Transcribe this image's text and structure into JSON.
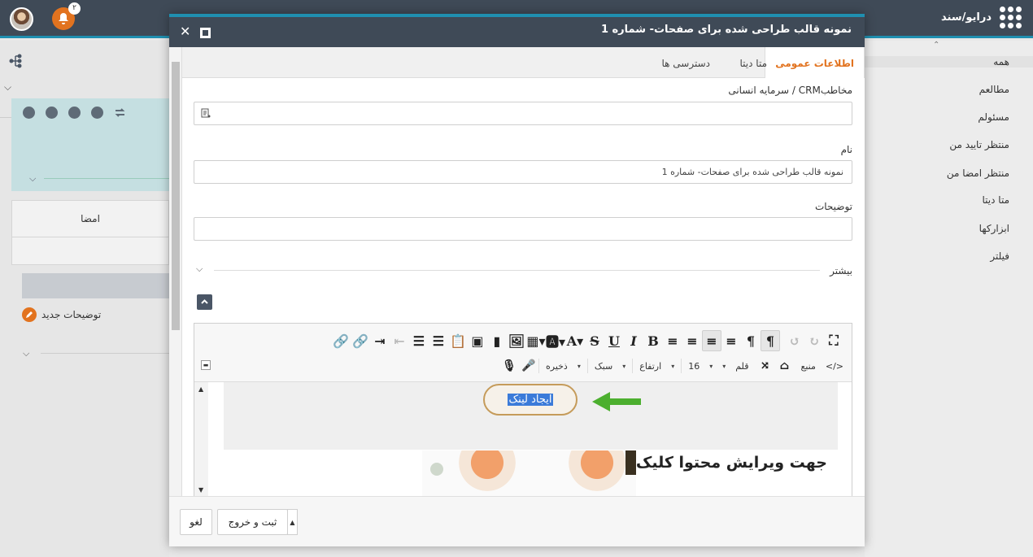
{
  "topbar": {
    "app_name": "درایو/سند",
    "notification_count": "۲"
  },
  "left_pane": {
    "signature_label": "امضا",
    "new_note_label": "توضیحات جدید"
  },
  "right_pane": {
    "items": [
      {
        "label": "همه"
      },
      {
        "label": "مطالعم"
      },
      {
        "label": "مسئولم"
      },
      {
        "label": "منتظر تایید من"
      },
      {
        "label": "منتظر امضا من"
      },
      {
        "label": "متا دیتا"
      },
      {
        "label": "ابزارکها"
      },
      {
        "label": "فیلتر"
      }
    ]
  },
  "modal": {
    "title": "نمونه قالب طراحی شده برای صفحات- شماره 1",
    "tabs": [
      {
        "label": "اطلاعات عمومی"
      },
      {
        "label": "متا دیتا"
      },
      {
        "label": "دسترسی ها"
      }
    ],
    "contact_label": "مخاطبCRM / سرمایه انسانی",
    "contact_value": "",
    "name_label": "نام",
    "name_value": "نمونه قالب طراحی شده برای صفحات- شماره 1",
    "description_label": "توضیحات",
    "description_value": "",
    "more_label": "بیشتر",
    "editor": {
      "source_label": "منبع",
      "font_label": "قلم",
      "size_value": "16",
      "height_label": "ارتفاع",
      "style_label": "سبک",
      "save_label": "ذخیره",
      "link_text": "ایجاد لینک",
      "headline": "جهت ویرایش محتوا کلیک"
    },
    "footer": {
      "save_exit_label": "ثبت و خروج",
      "cancel_label": "لغو"
    }
  },
  "colors": {
    "accent": "#e2731f",
    "header": "#3f4a57",
    "topline": "#1f8fb0",
    "arrow": "#4caf2f",
    "selection": "#3b7bd9"
  }
}
